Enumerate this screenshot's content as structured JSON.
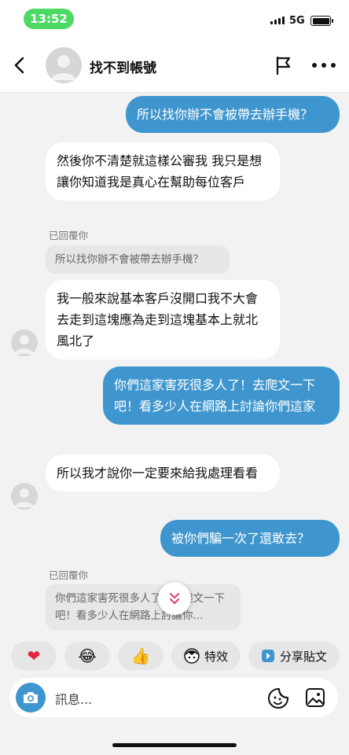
{
  "status": {
    "time": "13:52",
    "network": "5G",
    "battery_level": 1.0
  },
  "header": {
    "title": "找不到帳號"
  },
  "messages": [
    {
      "text": "所以找你辦不會被帶去辦手機？"
    },
    {
      "text": "然後你不清楚就這樣公審我 我只是想讓你知道我是真心在幫助每位客戶"
    },
    {
      "reply_label": "已回覆你",
      "reply_text": "所以找你辦不會被帶去辦手機？"
    },
    {
      "text": "我一般來說基本客戶沒開口我不大會去走到這塊應為走到這塊基本上就北風北了"
    },
    {
      "text": "你們這家害死很多人了！去爬文一下吧！看多少人在網路上討論你們這家"
    },
    {
      "text": "所以我才說你一定要來給我處理看看"
    },
    {
      "text": "被你們騙一次了還敢去？"
    },
    {
      "reply_label": "已回覆你",
      "reply_text": "你們這家害死很多人了！去爬文一下吧！看多少人在網路上討論你..."
    }
  ],
  "quick_replies": [
    {
      "icon": "heart",
      "emoji": "❤"
    },
    {
      "icon": "laugh",
      "emoji": "😂"
    },
    {
      "icon": "thumbs-up",
      "emoji": "👍"
    },
    {
      "icon": "effects",
      "label": "特效"
    },
    {
      "icon": "share",
      "label": "分享貼文"
    }
  ],
  "composer": {
    "placeholder": "訊息..."
  },
  "colors": {
    "accent": "#3f96ce",
    "status_pill": "#4cd964"
  }
}
